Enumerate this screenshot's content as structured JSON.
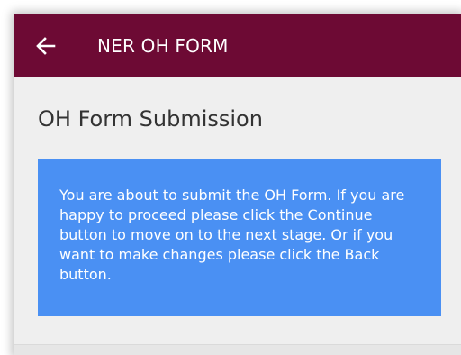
{
  "app_bar": {
    "title": "NER OH FORM",
    "back_icon": "arrow-left-icon",
    "background_color": "#6d0a34"
  },
  "page": {
    "heading": "OH Form Submission"
  },
  "info": {
    "message": "You are about to submit the OH Form. If you are happy to proceed please click the Continue button to move on to the next stage. Or if you want to make changes please click the Back button.",
    "background_color": "#4a90f3"
  }
}
